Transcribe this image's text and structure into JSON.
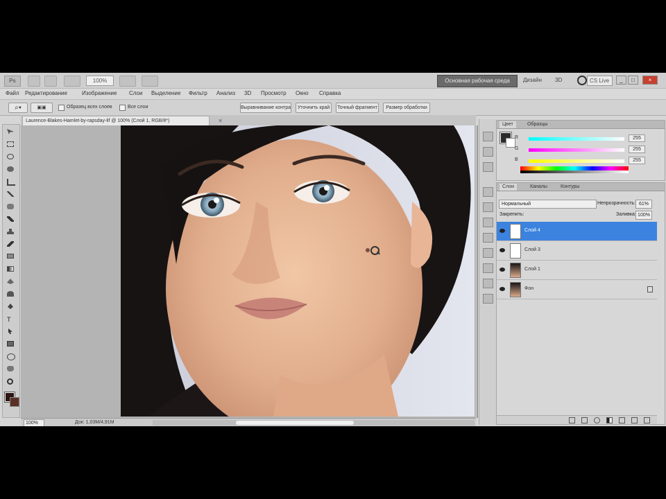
{
  "app": {
    "logo": "Ps",
    "zoom": "100%",
    "workspace": "Основная рабочая среда",
    "workspace_right": "Дизайн",
    "workspace_extra": "3D",
    "cs_live": "CS Live"
  },
  "menu": [
    "Файл",
    "Редактирование",
    "Изображение",
    "Слои",
    "Выделение",
    "Фильтр",
    "Анализ",
    "3D",
    "Просмотр",
    "Окно",
    "Справка"
  ],
  "options": {
    "check1": "Образец всех слоев",
    "check2": "Все слои",
    "btn1": "Выравнивание контраста",
    "btn2": "Уточнить край",
    "btn3": "Точный фрагмент",
    "btn4": "Размер обработки"
  },
  "document": {
    "tab_title": "Laurence-Blakes-Hamlet-by-rapsday-lif @ 100% (Слой 1, RGB/8*)",
    "close": "×",
    "zoom_percent": "100%",
    "doc_size": "Док: 1,03М/4,91М"
  },
  "color_panel": {
    "tabs": [
      "Цвет",
      "Образцы"
    ],
    "channels": [
      {
        "label": "R",
        "value": "255"
      },
      {
        "label": "G",
        "value": "255"
      },
      {
        "label": "B",
        "value": "255"
      }
    ]
  },
  "layers_panel": {
    "tabs": [
      "Слои",
      "Каналы",
      "Контуры"
    ],
    "blend_mode": "Нормальный",
    "opacity_label": "Непрозрачность:",
    "opacity": "61%",
    "lock_label": "Закрепить:",
    "fill_label": "Заливка:",
    "fill": "100%",
    "layers": [
      {
        "name": "Слой 4",
        "selected": true
      },
      {
        "name": "Слой 3",
        "selected": false
      },
      {
        "name": "Слой 1",
        "selected": false
      },
      {
        "name": "Фон",
        "selected": false
      }
    ]
  },
  "colors": {
    "selection": "#3b83df",
    "foreground": "#2a1612",
    "background": "#5a3026"
  }
}
